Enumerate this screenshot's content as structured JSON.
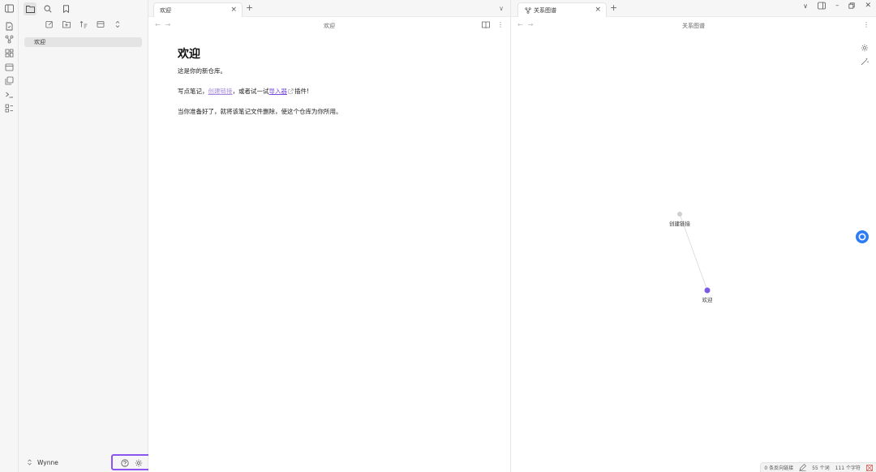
{
  "sidebar": {
    "file_items": [
      {
        "label": "欢迎"
      }
    ],
    "vault_name": "Wynne"
  },
  "left_pane": {
    "tab_title": "欢迎",
    "view_title": "欢迎",
    "document": {
      "heading": "欢迎",
      "para1": "这是你的新仓库。",
      "para2_prefix": "写点笔记，",
      "internal_link": "创建链接",
      "para2_middle": "，或者试一试",
      "external_link": "导入器",
      "para2_suffix": "插件!",
      "para3": "当你准备好了，就将该笔记文件删除，使这个仓库为你所用。"
    }
  },
  "right_pane": {
    "tab_title": "关系图谱",
    "view_title": "关系图谱",
    "graph": {
      "nodes": [
        {
          "id": "create-link",
          "label": "创建链接",
          "color": "#cfcfcf"
        },
        {
          "id": "welcome",
          "label": "欢迎",
          "color": "#7b5be6"
        }
      ],
      "edges": [
        {
          "from": "create-link",
          "to": "welcome"
        }
      ]
    }
  },
  "status_bar": {
    "backlinks": "0 条反向链接",
    "words": "55 个词",
    "chars": "111 个字符"
  },
  "colors": {
    "accent": "#7b5be6",
    "highlight_border": "#8a55f0",
    "floating_button": "#2d7cf6"
  }
}
